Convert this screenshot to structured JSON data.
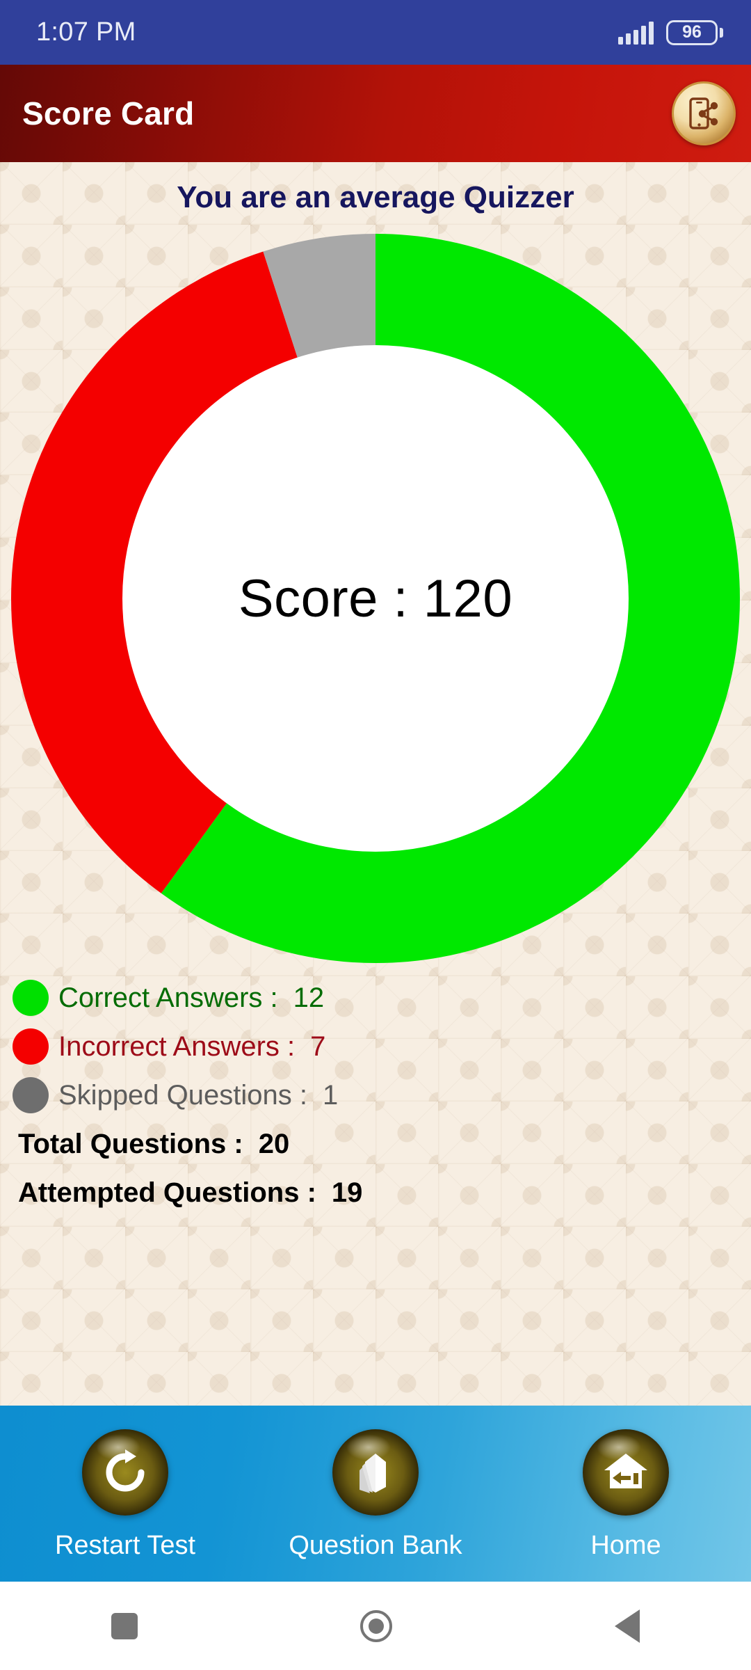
{
  "statusbar": {
    "time": "1:07 PM",
    "battery_level": "96",
    "signal_icon": "signal-bars-icon",
    "battery_icon": "battery-icon"
  },
  "appbar": {
    "title": "Score Card",
    "share_icon": "share-phone-icon",
    "gradient_from": "#640906",
    "gradient_to": "#cf1c10"
  },
  "main": {
    "headline": "You are an average Quizzer",
    "headline_color": "#16165e",
    "score_text": "Score : 120",
    "background_color": "#f7eee2"
  },
  "legend": [
    {
      "label": "Correct Answers :",
      "value": "12",
      "color": "#00e000",
      "text_color": "#046c04",
      "dot_name": "legend-dot-correct"
    },
    {
      "label": "Incorrect Answers :",
      "value": "7",
      "color": "#f40000",
      "text_color": "#9d0b18",
      "dot_name": "legend-dot-incorrect"
    },
    {
      "label": "Skipped Questions :",
      "value": "1",
      "color": "#6e6e6e",
      "text_color": "#5c5c5c",
      "dot_name": "legend-dot-skipped"
    }
  ],
  "stats": [
    {
      "label": "Total Questions :",
      "value": "20"
    },
    {
      "label": "Attempted Questions :",
      "value": "19"
    }
  ],
  "bottombar": [
    {
      "label": "Restart Test",
      "icon": "restart-refresh-icon"
    },
    {
      "label": "Question Bank",
      "icon": "book-icon"
    },
    {
      "label": "Home",
      "icon": "home-house-icon"
    }
  ],
  "androidnav": [
    {
      "name": "recents-button",
      "icon": "square-icon"
    },
    {
      "name": "home-button",
      "icon": "circle-icon"
    },
    {
      "name": "back-button",
      "icon": "triangle-back-icon"
    }
  ],
  "chart_data": {
    "type": "pie",
    "title": "Score : 120",
    "variant": "donut",
    "start_angle_deg": 0,
    "direction": "clockwise",
    "total": 20,
    "categories": [
      "Correct Answers",
      "Incorrect Answers",
      "Skipped Questions"
    ],
    "values": [
      12,
      7,
      1
    ],
    "percentages": [
      60,
      35,
      5
    ],
    "angles_deg": [
      216,
      126,
      18
    ],
    "colors": [
      "#00e800",
      "#f40000",
      "#a8a8a8"
    ],
    "legend": [
      "Correct Answers : 12",
      "Incorrect Answers : 7",
      "Skipped Questions : 1"
    ],
    "legend_position": "below",
    "grid": false,
    "xlabel": "",
    "ylabel": ""
  }
}
